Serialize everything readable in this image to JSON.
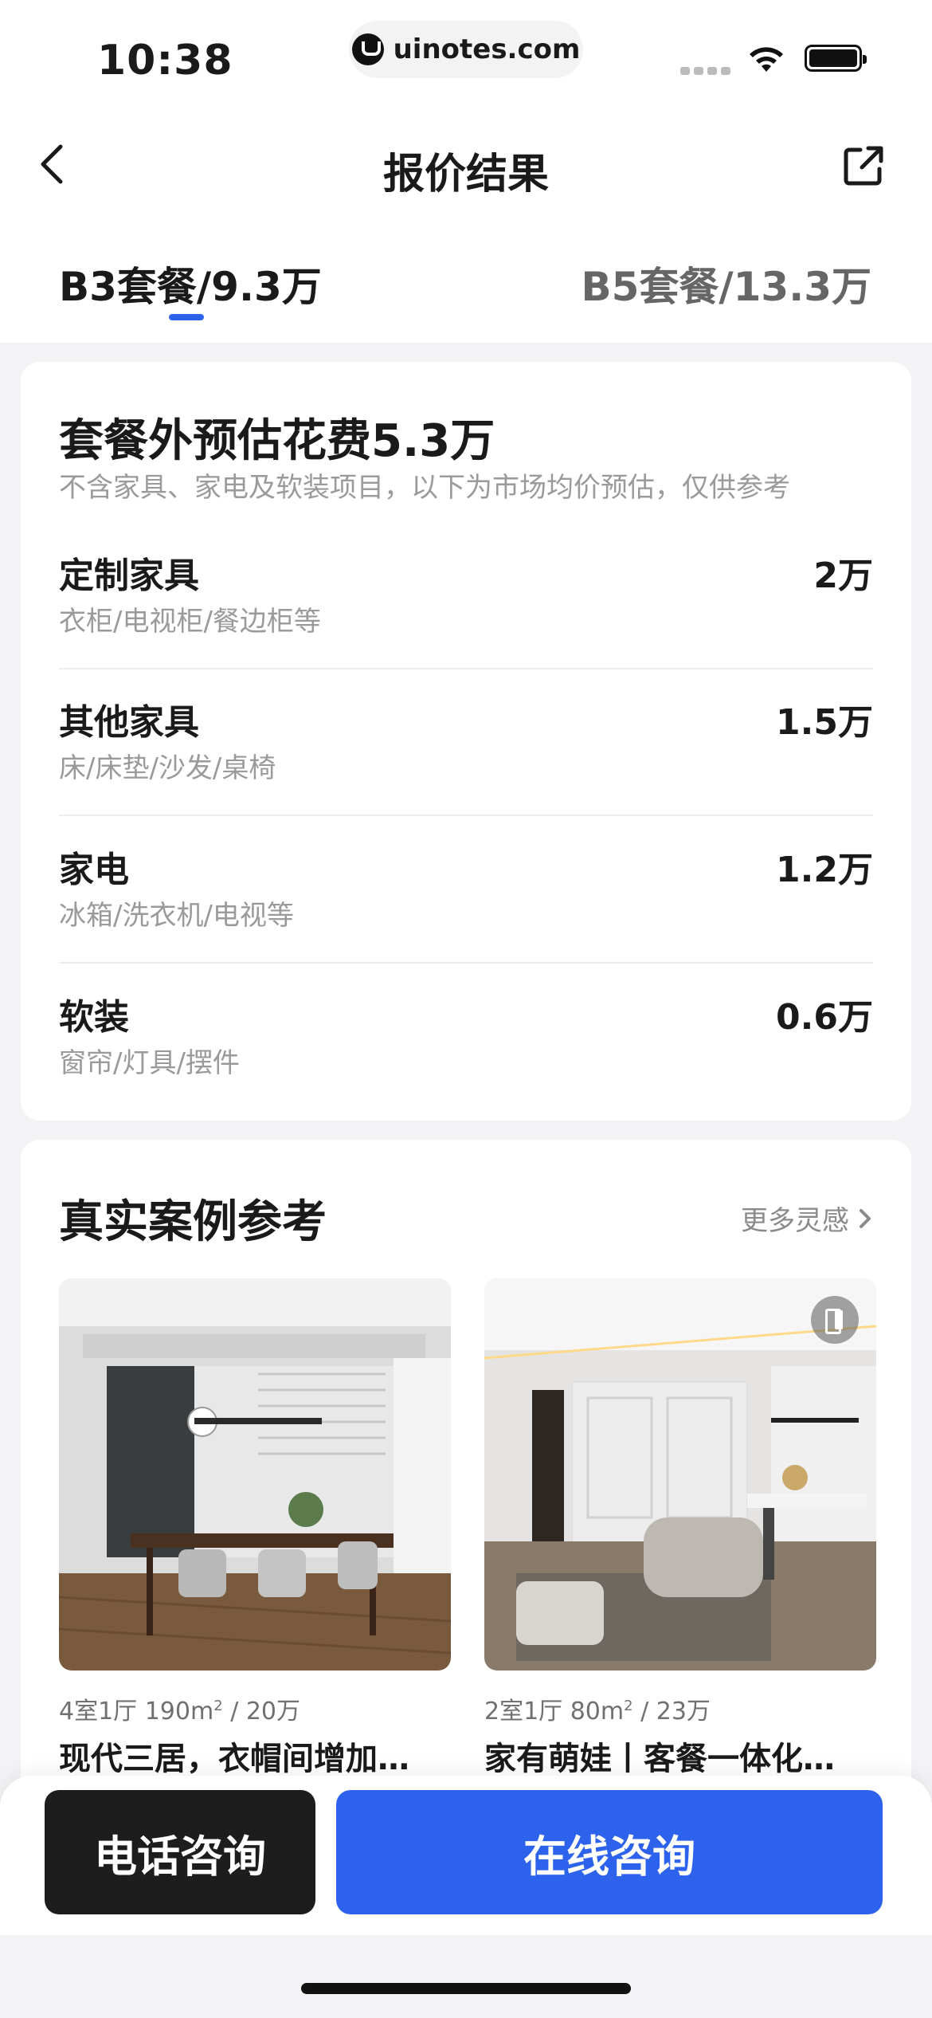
{
  "status_bar": {
    "time": "10:38",
    "url": "uinotes.com"
  },
  "nav": {
    "title": "报价结果",
    "back_icon": "chevron-left-icon",
    "share_icon": "share-external-icon"
  },
  "tabs": [
    {
      "label": "B3套餐/9.3万",
      "active": true
    },
    {
      "label": "B5套餐/13.3万",
      "active": false
    }
  ],
  "estimate": {
    "title": "套餐外预估花费5.3万",
    "subtitle": "不含家具、家电及软装项目，以下为市场均价预估，仅供参考",
    "items": [
      {
        "label": "定制家具",
        "desc": "衣柜/电视柜/餐边柜等",
        "value": "2万"
      },
      {
        "label": "其他家具",
        "desc": "床/床垫/沙发/桌椅",
        "value": "1.5万"
      },
      {
        "label": "家电",
        "desc": "冰箱/洗衣机/电视等",
        "value": "1.2万"
      },
      {
        "label": "软装",
        "desc": "窗帘/灯具/摆件",
        "value": "0.6万"
      }
    ]
  },
  "cases": {
    "title": "真实案例参考",
    "more_label": "更多灵感",
    "items": [
      {
        "meta_pre": "4室1厅 190m",
        "meta_sup": "2",
        "meta_post": " / 20万",
        "name": "现代三居，衣帽间增加…"
      },
      {
        "meta_pre": "2室1厅 80m",
        "meta_sup": "2",
        "meta_post": " / 23万",
        "name": "家有萌娃丨客餐一体化…"
      }
    ]
  },
  "actions": {
    "phone_label": "电话咨询",
    "online_label": "在线咨询"
  },
  "colors": {
    "accent": "#2d63ec",
    "dark_button": "#1d1d1d",
    "background": "#f3f3f5"
  }
}
